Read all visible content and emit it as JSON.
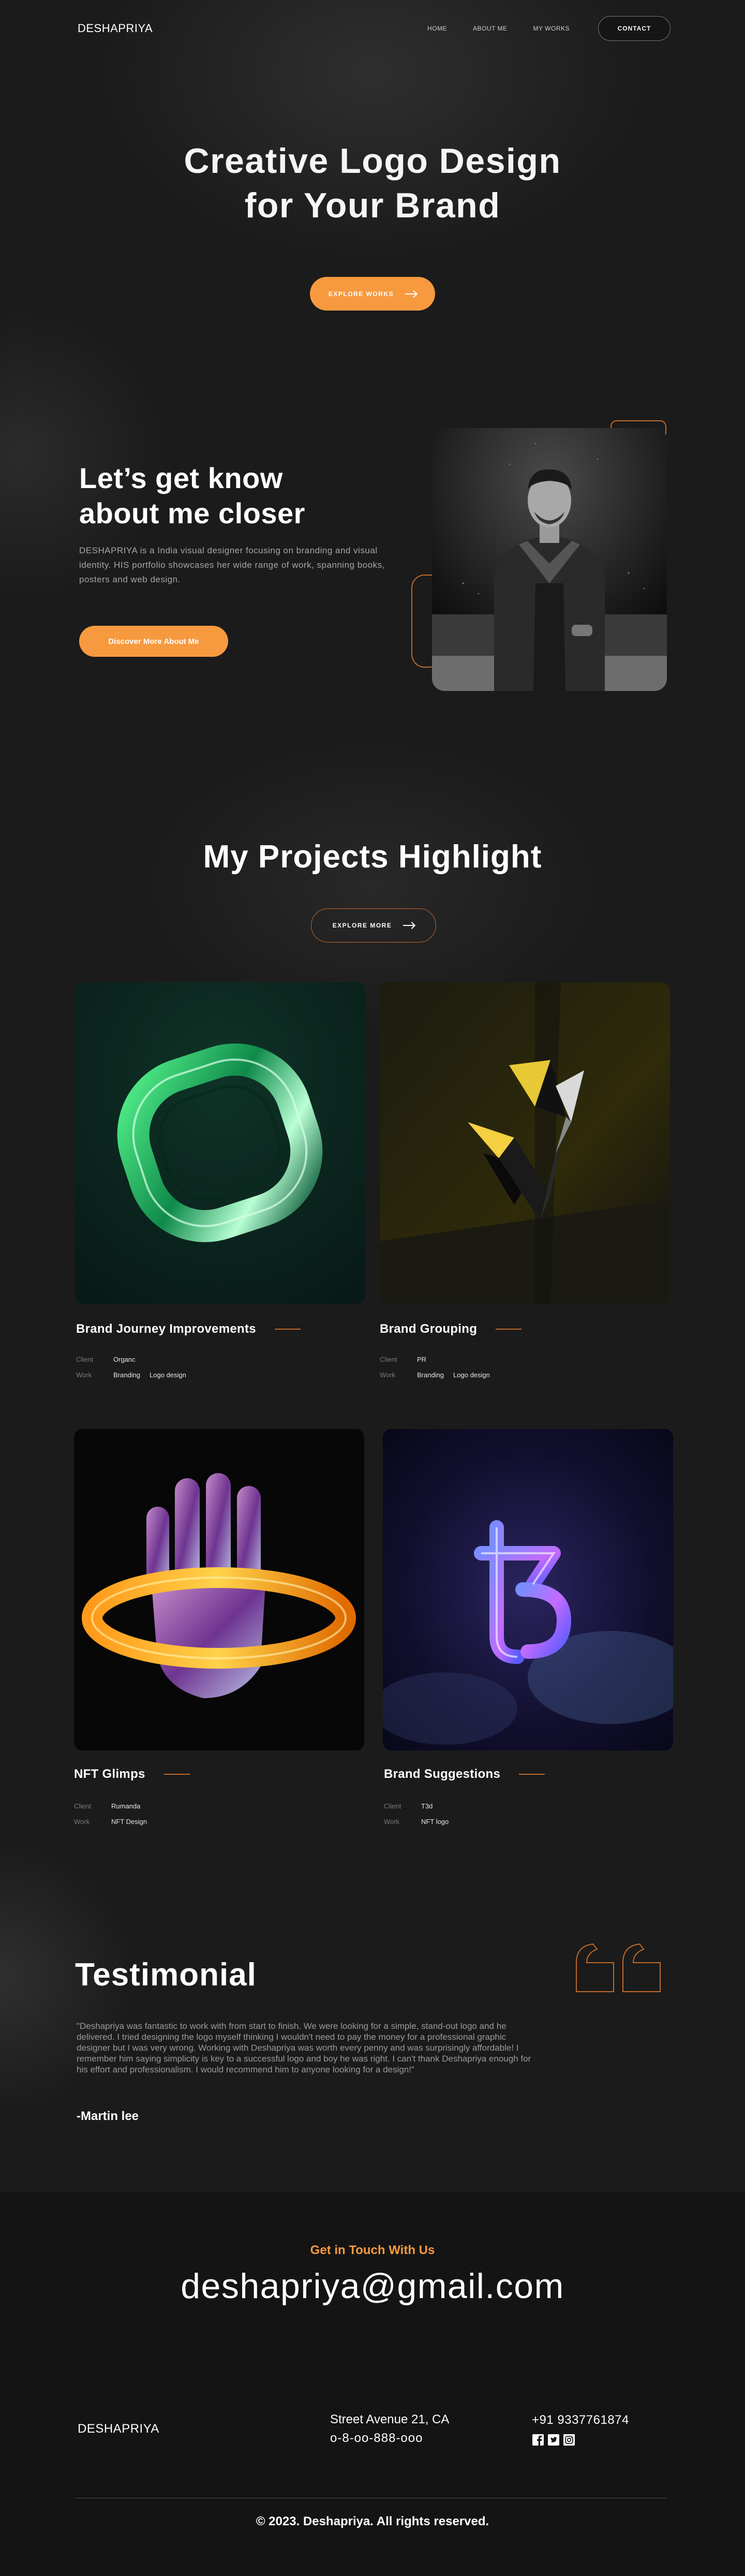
{
  "nav": {
    "logo": "DESHAPRIYA",
    "links": [
      "HOME",
      "ABOUT ME",
      "MY WORKS"
    ],
    "contact": "CONTACT"
  },
  "hero": {
    "title_line1": "Creative Logo Design",
    "title_line2": "for Your Brand",
    "button": "EXPLORE WORKS"
  },
  "about": {
    "title_line1": "Let’s get know",
    "title_line2": "about me closer",
    "text": "DESHAPRIYA is a India visual designer focusing on branding and visual identity. HIS portfolio showcases her wide range of work, spanning books, posters and web design.",
    "button": "Discover More About Me"
  },
  "projects": {
    "title": "My Projects Highlight",
    "button": "EXPLORE MORE",
    "client_label": "Client",
    "work_label": "Work",
    "items": [
      {
        "title": "Brand Journey Improvements",
        "client": "Organc",
        "work": [
          "Branding",
          "Logo design"
        ]
      },
      {
        "title": "Brand Grouping",
        "client": "PR",
        "work": [
          "Branding",
          "Logo design"
        ]
      },
      {
        "title": "NFT Glimps",
        "client": "Rumanda",
        "work": [
          "NFT Design"
        ]
      },
      {
        "title": "Brand Suggestions",
        "client": "T3d",
        "work": [
          "NFT logo"
        ]
      }
    ]
  },
  "testimonial": {
    "title": "Testimonial",
    "text": "\"Deshapriya was fantastic to work with from start to finish. We were looking for a simple, stand-out logo and he delivered. I tried designing the logo myself thinking I wouldn't need to pay the money for a professional graphic designer but I was very wrong. Working with Deshapriya was worth every penny and was surprisingly affordable! I remember him saying simplicity is key to a successful logo and boy he was right. I can't thank Deshapriya enough for his effort and professionalism. I would recommend him to anyone looking for a design!\"",
    "author": "-Martin lee"
  },
  "footer": {
    "get_in_touch": "Get in Touch With Us",
    "email": "deshapriya@gmail.com",
    "logo": "DESHAPRIYA",
    "address": "Street Avenue 21, CA",
    "phone_alt": "o-8-oo-888-ooo",
    "phone": "+91 9337761874",
    "social_icons": [
      "facebook-icon",
      "twitter-icon",
      "instagram-icon"
    ],
    "copyright": "© 2023. Deshapriya. All rights reserved."
  },
  "colors": {
    "accent": "#f79a3f",
    "background": "#1b1b1b",
    "footer_background": "#141414"
  }
}
